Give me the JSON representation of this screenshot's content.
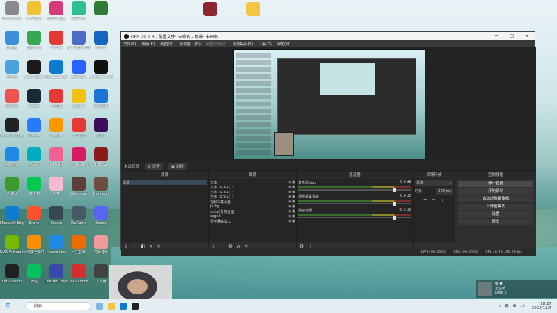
{
  "colors": {
    "obs_bg": "#2b2b2b",
    "dock_bg": "#252525",
    "taskbar_bg": "#e4eef2"
  },
  "desktop_icons": [
    {
      "label": "XxMobilexx",
      "color": "#8a8a8a"
    },
    {
      "label": "PotPlayer",
      "color": "#f1c232"
    },
    {
      "label": "剪映专业版",
      "color": "#d53a7a"
    },
    {
      "label": "我的生命",
      "color": "#2fbf8f"
    },
    {
      "label": "",
      "color": "#2e7d32"
    },
    {
      "label": "此电脑",
      "color": "#3a8fd8"
    },
    {
      "label": "迅雷下载",
      "color": "#34a853"
    },
    {
      "label": "Yandex",
      "color": "#e53935"
    },
    {
      "label": "Wallpaper Engine",
      "color": "#4b6cc4"
    },
    {
      "label": "MEmu",
      "color": "#1565c0"
    },
    {
      "label": "回收站",
      "color": "#4aa3df"
    },
    {
      "label": "Xbox Game",
      "color": "#1a1a1a"
    },
    {
      "label": "Microsoft Edge",
      "color": "#0f7ad1"
    },
    {
      "label": "腾讯游戏",
      "color": "#2962ff"
    },
    {
      "label": "Logitech G HUB",
      "color": "#111"
    },
    {
      "label": "腾讯QQ",
      "color": "#ef5350"
    },
    {
      "label": "Steam",
      "color": "#1b2838"
    },
    {
      "label": "YY语音",
      "color": "#e53935"
    },
    {
      "label": "QQ音乐",
      "color": "#f4c20d"
    },
    {
      "label": "百度网盘",
      "color": "#1976d2"
    },
    {
      "label": "Street Fighter 6",
      "color": "#222"
    },
    {
      "label": "ToDesk",
      "color": "#2979ff"
    },
    {
      "label": "Weixin",
      "color": "#ff9800"
    },
    {
      "label": "千千音乐",
      "color": "#e53935"
    },
    {
      "label": "EPIC",
      "color": "#3a0e5a"
    },
    {
      "label": "控制面板",
      "color": "#1e88e5"
    },
    {
      "label": "小黑盒",
      "color": "#00acc1"
    },
    {
      "label": "Pico VR",
      "color": "#f06292"
    },
    {
      "label": "GoodGame",
      "color": "#d81b60"
    },
    {
      "label": "Dota 2",
      "color": "#8b1a1a"
    },
    {
      "label": "NVIDIA",
      "color": "#3b9a2b"
    },
    {
      "label": "ZOOM",
      "color": "#00c853"
    },
    {
      "label": "原神",
      "color": "#f8bbd0"
    },
    {
      "label": "Wallpaper",
      "color": "#5d4037"
    },
    {
      "label": "Dungeon",
      "color": "#6d4c41"
    },
    {
      "label": "Microsoft Edge",
      "color": "#0f7ad1"
    },
    {
      "label": "Brave",
      "color": "#fb542b"
    },
    {
      "label": "Steam",
      "color": "#37474f"
    },
    {
      "label": "WeGame",
      "color": "#455a64"
    },
    {
      "label": "Discord",
      "color": "#5865f2"
    },
    {
      "label": "NVIDIA Broadcast",
      "color": "#76b900"
    },
    {
      "label": "火绒安全软件",
      "color": "#ff8f00"
    },
    {
      "label": "Maono Link",
      "color": "#1e88e5"
    },
    {
      "label": "一生音频",
      "color": "#ef6c00"
    },
    {
      "label": "可靠音频",
      "color": "#ef9a9a"
    },
    {
      "label": "OBS Studio",
      "color": "#212121"
    },
    {
      "label": "微信",
      "color": "#07c160"
    },
    {
      "label": "Charted Together",
      "color": "#3949ab"
    },
    {
      "label": "WPS Office",
      "color": "#d32f2f"
    },
    {
      "label": "下载器",
      "color": "#424242"
    }
  ],
  "top_files": [
    {
      "label": "",
      "color": "#8e2430"
    },
    {
      "label": "",
      "color": "#f4c542"
    }
  ],
  "obs": {
    "title": "OBS 29.1.3 - 配置文件: 未命名 - 场景: 未命名",
    "menu": [
      "文件(F)",
      "编辑(E)",
      "视图(V)",
      "停靠窗口(D)",
      "配置文件(P)",
      "场景集合(S)",
      "工具(T)",
      "帮助(H)"
    ],
    "menu_dim": [
      false,
      false,
      false,
      false,
      true,
      false,
      false,
      false
    ],
    "scenebar_text": "未选择源",
    "scenebar_btn1": "设置",
    "scenebar_btn2": "滤镜",
    "docks": {
      "scenes_title": "场景",
      "scene_item": "场景",
      "sources_title": "来源",
      "sources": [
        "文本",
        "文本 (GDI+) 3",
        "文本 (GDI+) 3",
        "文本 (GDI+) 2",
        "视频采集设备",
        "pubg",
        "dota2专用画面",
        "csgo2",
        "显示器采集 2"
      ],
      "mixer_title": "混音器",
      "mixer": [
        {
          "name": "麦克风/Aux",
          "db": "0.0 dB"
        },
        {
          "name": "视频采集设备",
          "db": "0.0 dB"
        },
        {
          "name": "桌面音频",
          "db": "-0.3 dB"
        }
      ],
      "transitions_title": "转场特效",
      "transition_type": "渐变",
      "duration_label": "时长",
      "duration_value": "300 ms",
      "controls_title": "控制按钮",
      "controls": [
        "停止直播",
        "开始录制",
        "启动虚拟摄像机",
        "工作室模式",
        "设置",
        "退出"
      ]
    },
    "status": {
      "live": "LIVE: 00:00:00",
      "rec": "REC: 00:00:00",
      "cpu": "CPU: 0.4%, 60.00 fps"
    }
  },
  "media": {
    "title": "0.0",
    "sub": "正在听",
    "app": "Dota 2"
  },
  "taskbar": {
    "search_placeholder": "搜索",
    "tray_lang": "英",
    "time": "18:27",
    "date": "2025/12/7"
  }
}
